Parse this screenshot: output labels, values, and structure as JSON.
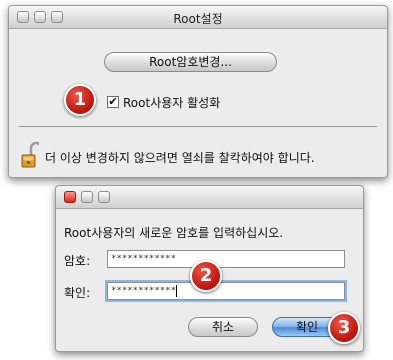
{
  "root_window": {
    "title": "Root설정",
    "change_password_button": "Root암호변경...",
    "enable_root_label": "Root사용자 활성화",
    "enable_root_checked": true,
    "lock_message": "더 이상 변경하지 않으려면 열쇠를 찰칵하여야 합니다."
  },
  "password_dialog": {
    "prompt": "Root사용자의 새로운 암호를 입력하십시오.",
    "password_label": "암호:",
    "password_value": "************",
    "verify_label": "확인:",
    "verify_value": "************",
    "cancel_button": "취소",
    "ok_button": "확인"
  },
  "annotations": [
    "1",
    "2",
    "3"
  ],
  "colors": {
    "badge": "#d01e14",
    "default_button": "#5b9be0",
    "window_background": "#ececec"
  }
}
